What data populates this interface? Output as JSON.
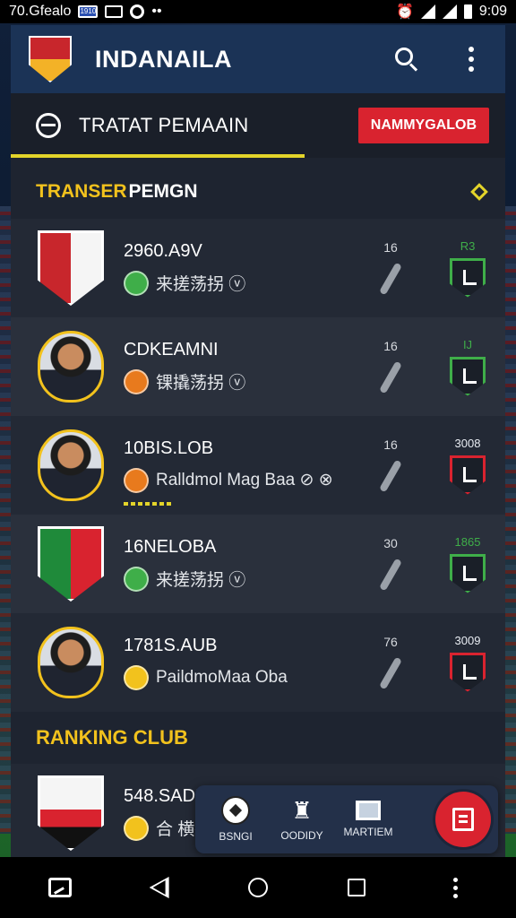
{
  "status_bar": {
    "left_text": "70.Gfealo",
    "carrier_badge": "1910",
    "time": "9:09"
  },
  "app_bar": {
    "title": "INDANAILA",
    "icons": [
      "club-logo",
      "search-icon",
      "more-vert-icon"
    ]
  },
  "section": {
    "tab_title": "TRATAT PEMAAIN",
    "action_button": "NAMMYGALOB"
  },
  "transfer_header": {
    "part1": "TRANSER",
    "part2": "PEMGN"
  },
  "colors": {
    "accent_yellow": "#f2c21d",
    "accent_red": "#d9232f",
    "appbar_blue": "#1b3356",
    "panel": "#1e2430",
    "shield_green": "#3fae49",
    "shield_red": "#d9232f"
  },
  "rows": [
    {
      "title": "2960.A9V",
      "subtitle": "来搓荡拐 ⓥ",
      "stat": "16",
      "score": "R3",
      "score_kind": "green",
      "emblem": "crest",
      "emblem_colors": [
        "#c8262c",
        "#f5f5f5"
      ],
      "dot_color": "#3fae49"
    },
    {
      "title": "CDKEAMNI",
      "subtitle": "锞撬荡拐 ⓥ",
      "stat": "16",
      "score": "IJ",
      "score_kind": "green",
      "emblem": "photo",
      "dot_color": "#e87a1d"
    },
    {
      "title": "10BIS.LOB",
      "subtitle": "Ralldmol Mag Baa ⊘ ⊗",
      "stat": "16",
      "score": "3008",
      "score_kind": "red",
      "emblem": "photo",
      "dot_color": "#e87a1d"
    },
    {
      "title": "16NELOBA",
      "subtitle": "来搓荡拐 ⓥ",
      "stat": "30",
      "score": "1865",
      "score_kind": "green",
      "emblem": "crest",
      "emblem_colors": [
        "#1f8a3a",
        "#d9232f"
      ],
      "dot_color": "#3fae49"
    },
    {
      "title": "1781S.AUB",
      "subtitle": "PaildmoMaa Oba",
      "stat": "76",
      "score": "3009",
      "score_kind": "red",
      "emblem": "photo",
      "dot_color": "#f2c21d"
    }
  ],
  "ranking": {
    "title": "RANKING CLUB",
    "row": {
      "title": "548.SADI",
      "subtitle": "合 横拐",
      "dot_color": "#f2c21d"
    }
  },
  "dock": {
    "items": [
      {
        "label": "BSNGI",
        "icon": "ball-icon"
      },
      {
        "label": "OODIDY",
        "icon": "player-icon"
      },
      {
        "label": "MARTIEM",
        "icon": "flag-icon"
      }
    ],
    "fab_icon": "edit-icon"
  },
  "nav_bar": {
    "icons": [
      "screenshot-icon",
      "back-icon",
      "home-icon",
      "recents-icon",
      "more-icon"
    ]
  }
}
